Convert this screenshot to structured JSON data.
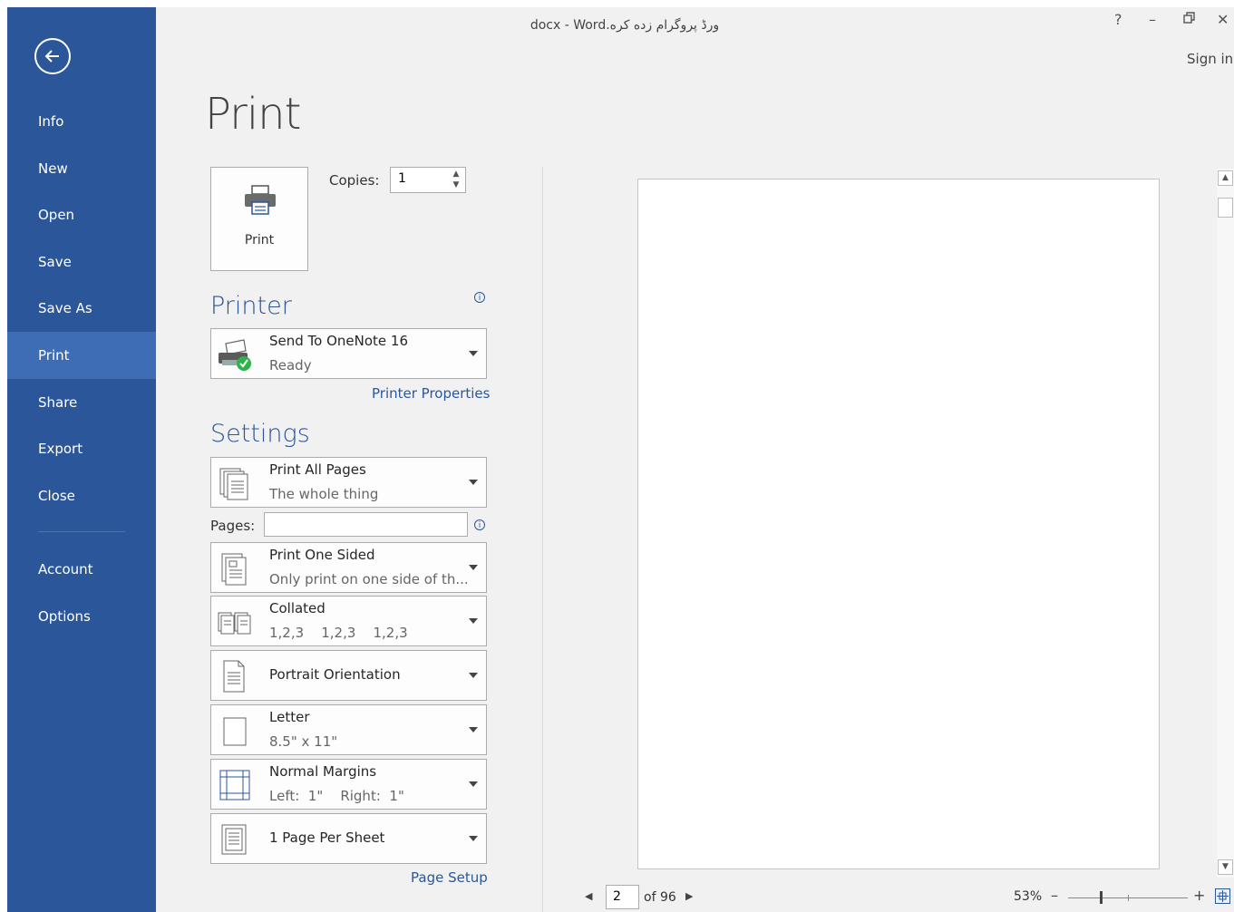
{
  "window": {
    "title": "ورڈ پروگرام زده کره.docx - Word",
    "help": "?",
    "minimize": "–",
    "restore": "🗗",
    "close": "✕",
    "sign_in": "Sign in"
  },
  "sidebar": {
    "items": [
      {
        "label": "Info"
      },
      {
        "label": "New"
      },
      {
        "label": "Open"
      },
      {
        "label": "Save"
      },
      {
        "label": "Save As"
      },
      {
        "label": "Print",
        "active": true
      },
      {
        "label": "Share"
      },
      {
        "label": "Export"
      },
      {
        "label": "Close"
      },
      {
        "label": "Account"
      },
      {
        "label": "Options"
      }
    ]
  },
  "page_title": "Print",
  "print_button": {
    "label": "Print"
  },
  "copies": {
    "label": "Copies:",
    "value": "1"
  },
  "printer": {
    "heading": "Printer",
    "name": "Send To OneNote 16",
    "status": "Ready",
    "properties_link": "Printer Properties"
  },
  "settings": {
    "heading": "Settings",
    "pages_label": "Pages:",
    "pages_value": "",
    "options": [
      {
        "title": "Print All Pages",
        "subtitle": "The whole thing"
      },
      {
        "title": "Print One Sided",
        "subtitle": "Only print on one side of th..."
      },
      {
        "title": "Collated",
        "subtitle": "1,2,3    1,2,3    1,2,3"
      },
      {
        "title": "Portrait Orientation",
        "subtitle": ""
      },
      {
        "title": "Letter",
        "subtitle": "8.5\" x 11\""
      },
      {
        "title": "Normal Margins",
        "subtitle": "Left:  1\"    Right:  1\""
      },
      {
        "title": "1 Page Per Sheet",
        "subtitle": ""
      }
    ],
    "page_setup_link": "Page Setup"
  },
  "preview_nav": {
    "current_page": "2",
    "of_text": "of 96"
  },
  "zoom": {
    "percent": "53%",
    "minus": "–",
    "plus": "+"
  },
  "icons": {
    "info": "i",
    "prev": "◀",
    "next": "▶",
    "scroll_up": "▲",
    "scroll_down": "▼"
  },
  "colors": {
    "accent": "#2b579a",
    "sidebar": "#2b579a",
    "sidebar_active": "#3e6db5",
    "ready_check": "#2fb24b"
  }
}
